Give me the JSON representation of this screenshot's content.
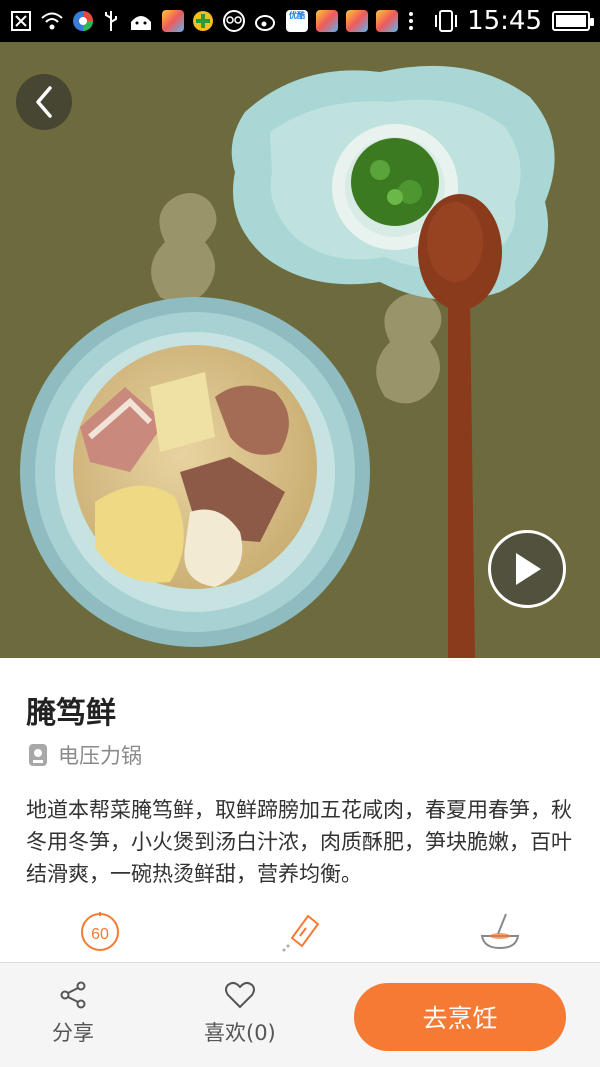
{
  "status_bar": {
    "time": "15:45",
    "left_icons": [
      "close-box-icon",
      "wifi-icon",
      "app-colorful-icon",
      "usb-icon",
      "android-icon",
      "app-store-icon",
      "green-app-icon",
      "glasses-icon",
      "weibo-icon",
      "youku-icon",
      "app-store-icon",
      "app-store-icon",
      "app-store-icon",
      "more-icon"
    ],
    "youku_text": "优酷"
  },
  "hero": {
    "back_icon": "chevron-left-icon",
    "play_icon": "play-icon"
  },
  "recipe": {
    "title": "腌笃鲜",
    "device_icon": "pressure-cooker-icon",
    "device": "电压力锅",
    "description": "地道本帮菜腌笃鲜，取鲜蹄膀加五花咸肉，春夏用春笋，秋冬用冬笋，小火煲到汤白汁浓，肉质酥肥，笋块脆嫩，百叶结滑爽，一碗热烫鲜甜，营养均衡。",
    "info_icons": [
      {
        "name": "timer-icon",
        "value": "60"
      },
      {
        "name": "seasoning-icon",
        "value": ""
      },
      {
        "name": "mixing-bowl-icon",
        "value": ""
      }
    ]
  },
  "bottom_bar": {
    "share_label": "分享",
    "share_icon": "share-icon",
    "like_label": "喜欢(0)",
    "like_icon": "heart-icon",
    "cook_label": "去烹饪"
  },
  "colors": {
    "accent": "#f57a34",
    "background_cloth": "#6b6a3c"
  }
}
